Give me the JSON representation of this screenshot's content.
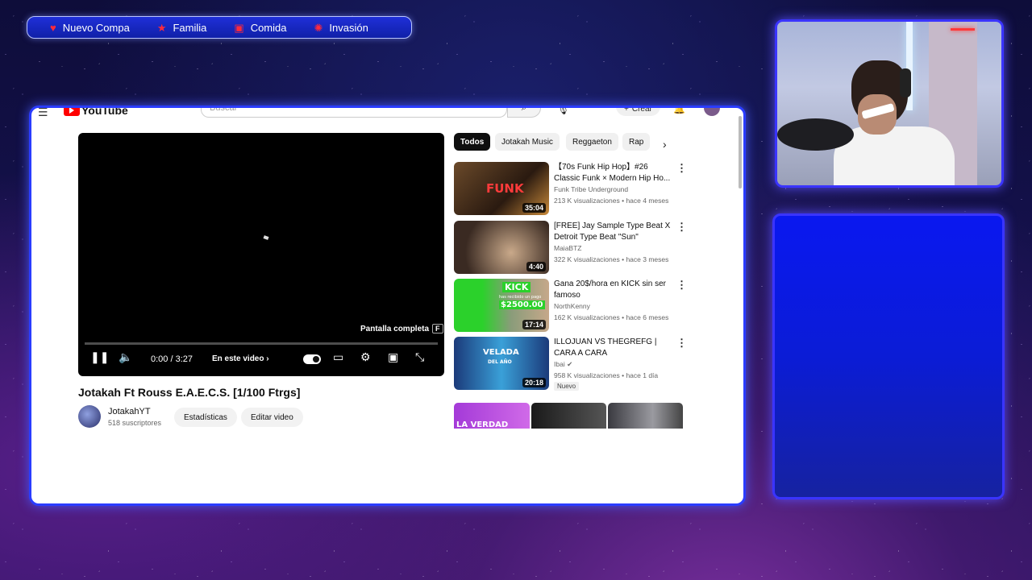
{
  "overlay_nav": {
    "items": [
      {
        "label": "Nuevo Compa",
        "icon": "heart-icon"
      },
      {
        "label": "Familia",
        "icon": "star-icon"
      },
      {
        "label": "Comida",
        "icon": "gift-icon"
      },
      {
        "label": "Invasión",
        "icon": "alien-icon"
      }
    ]
  },
  "youtube": {
    "logo_text": "YouTube",
    "search_placeholder": "Buscar",
    "create_label": "Crear",
    "player": {
      "time": "0:00 / 3:27",
      "chapter_label": "En este video",
      "fullscreen_tip": "Pantalla completa",
      "fullscreen_key": "F",
      "progress": 0
    },
    "video": {
      "title": "Jotakah Ft Rouss E.A.E.C.S. [1/100 Ftrgs]",
      "channel": "JotakahYT",
      "subscribers": "518 suscriptores",
      "stats_button": "Estadísticas",
      "edit_button": "Editar video"
    },
    "chips": [
      "Todos",
      "Jotakah Music",
      "Reggaeton",
      "Rap"
    ],
    "recommendations": [
      {
        "title": "【70s Funk Hip Hop】#26 Classic Funk × Modern Hip Ho...",
        "channel": "Funk Tribe Underground",
        "meta": "213 K visualizaciones • hace 4 meses",
        "duration": "35:04",
        "thumb_text": "FUNK"
      },
      {
        "title": "[FREE] Jay Sample Type Beat X Detroit Type Beat \"Sun\"",
        "channel": "MaiaBTZ",
        "meta": "322 K visualizaciones • hace 3 meses",
        "duration": "4:40"
      },
      {
        "title": "Gana 20$/hora en KICK sin ser famoso",
        "channel": "NorthKenny",
        "meta": "162 K visualizaciones • hace 6 meses",
        "duration": "17:14",
        "thumb_text": "KICK",
        "thumb_sub": "has recibido un pago",
        "thumb_amount": "$2500.00"
      },
      {
        "title": "ILLOJUAN VS THEGREFG | CARA A CARA",
        "channel": "Ibai",
        "meta": "958 K visualizaciones • hace 1 día",
        "duration": "20:18",
        "badge": "Nuevo",
        "thumb_text": "VELADA",
        "thumb_sub": "DEL AÑO"
      }
    ],
    "shorts_partial_text": "LA VERDAD"
  },
  "colors": {
    "frame_border": "#2a3cff",
    "nav_fill": "#1020a8",
    "heart_red": "#ff2a3d",
    "youtube_red": "#ff0000",
    "panel_blue": "#0b1cd6"
  }
}
